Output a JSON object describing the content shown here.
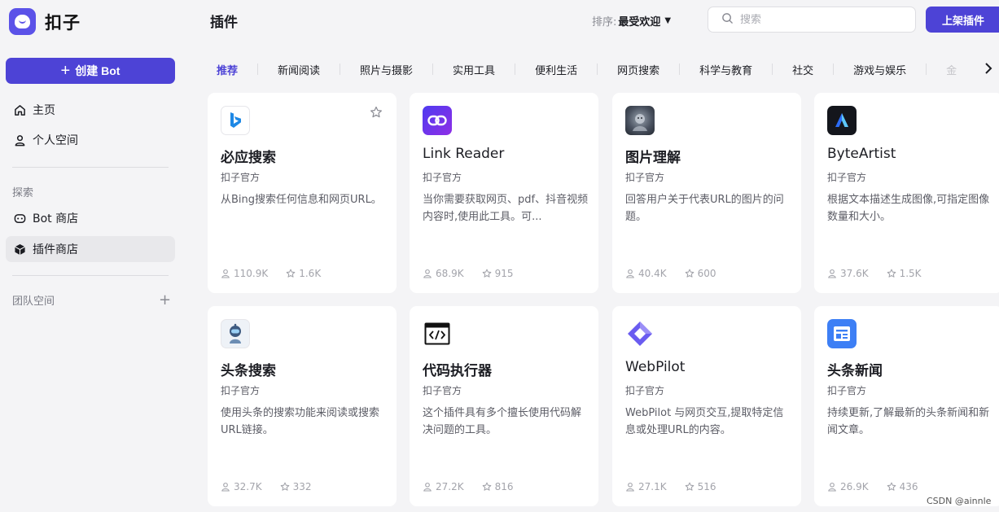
{
  "app": {
    "logo_text": "扣子"
  },
  "sidebar": {
    "create_label": "创建 Bot",
    "home": "主页",
    "personal": "个人空间",
    "explore_label": "探索",
    "bot_store": "Bot 商店",
    "plugin_store": "插件商店",
    "team_label": "团队空间"
  },
  "header": {
    "title": "插件",
    "sort_label": "排序:",
    "sort_value": "最受欢迎",
    "search_placeholder": "搜索",
    "publish_label": "上架插件"
  },
  "tabs": [
    "推荐",
    "新闻阅读",
    "照片与摄影",
    "实用工具",
    "便利生活",
    "网页搜索",
    "科学与教育",
    "社交",
    "游戏与娱乐",
    "金"
  ],
  "cards": [
    {
      "name": "必应搜索",
      "author": "扣子官方",
      "desc": "从Bing搜索任何信息和网页URL。",
      "users": "110.9K",
      "stars": "1.6K",
      "icon": "bing-icon"
    },
    {
      "name": "Link Reader",
      "author": "扣子官方",
      "desc": "当你需要获取网页、pdf、抖音视频内容时,使用此工具。可...",
      "users": "68.9K",
      "stars": "915",
      "icon": "link-icon"
    },
    {
      "name": "图片理解",
      "author": "扣子官方",
      "desc": "回答用户关于代表URL的图片的问题。",
      "users": "40.4K",
      "stars": "600",
      "icon": "image-understanding-icon"
    },
    {
      "name": "ByteArtist",
      "author": "扣子官方",
      "desc": "根据文本描述生成图像,可指定图像数量和大小。",
      "users": "37.6K",
      "stars": "1.5K",
      "icon": "byteartist-icon"
    },
    {
      "name": "头条搜索",
      "author": "扣子官方",
      "desc": "使用头条的搜索功能来阅读或搜索URL链接。",
      "users": "32.7K",
      "stars": "332",
      "icon": "robot-icon"
    },
    {
      "name": "代码执行器",
      "author": "扣子官方",
      "desc": "这个插件具有多个擅长使用代码解决问题的工具。",
      "users": "27.2K",
      "stars": "816",
      "icon": "code-icon"
    },
    {
      "name": "WebPilot",
      "author": "扣子官方",
      "desc": "WebPilot 与网页交互,提取特定信息或处理URL的内容。",
      "users": "27.1K",
      "stars": "516",
      "icon": "webpilot-icon"
    },
    {
      "name": "头条新闻",
      "author": "扣子官方",
      "desc": "持续更新,了解最新的头条新闻和新闻文章。",
      "users": "26.9K",
      "stars": "436",
      "icon": "news-icon"
    }
  ],
  "watermark": "CSDN @ainnle",
  "colors": {
    "accent": "#4d43d6",
    "background": "#f4f4f6"
  }
}
